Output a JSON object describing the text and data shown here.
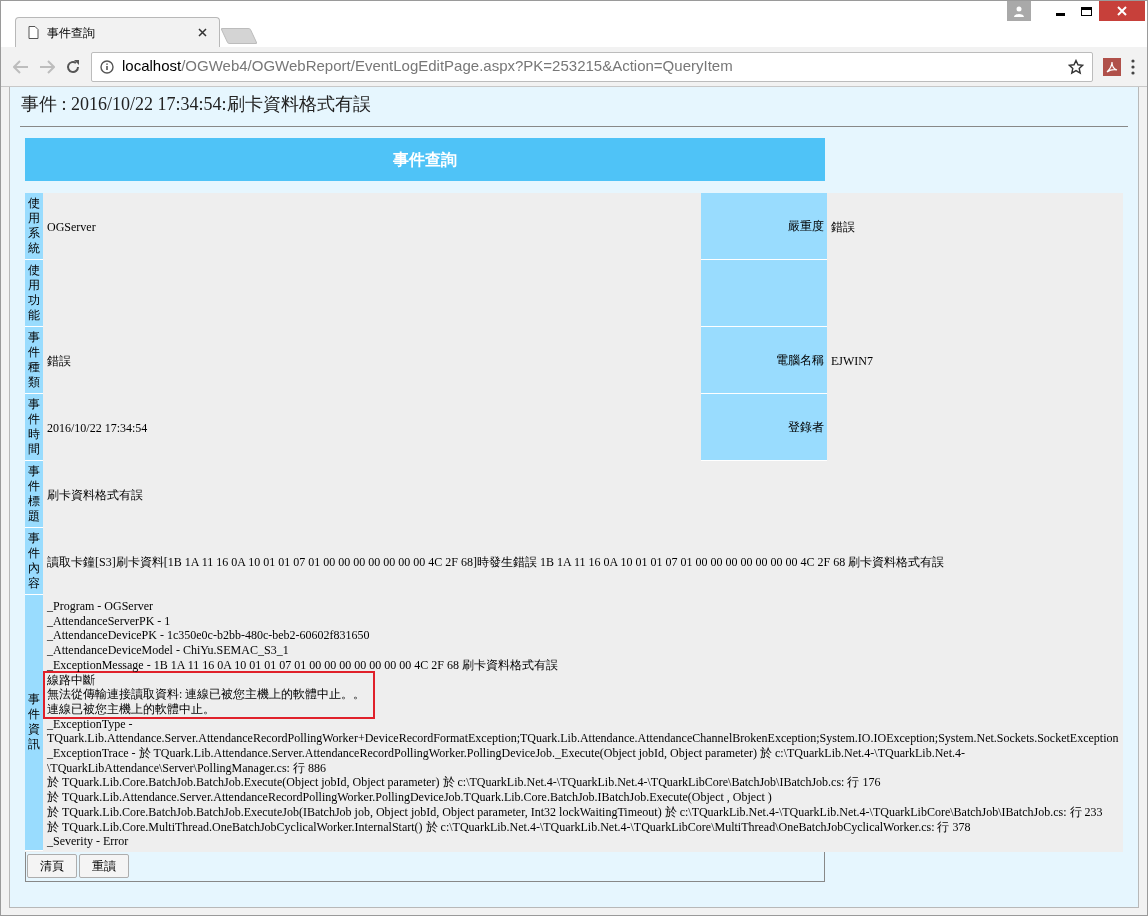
{
  "browser": {
    "tab_title": "事件查詢",
    "url_host": "localhost",
    "url_path": "/OGWeb4/OGWebReport/EventLogEditPage.aspx?PK=253215&Action=QueryItem"
  },
  "page_title": "事件 : 2016/10/22 17:34:54:刷卡資料格式有誤",
  "panel_title": "事件查詢",
  "rows": [
    {
      "label": "使用系統",
      "value": "OGServer",
      "right_label": "嚴重度",
      "right_value": "錯誤",
      "has_right": true
    },
    {
      "label": "使用功能",
      "has_right": true
    },
    {
      "label": "事件種類",
      "value": "錯誤",
      "right_label": "電腦名稱",
      "right_value": "EJWIN7",
      "has_right": true
    },
    {
      "label": "事件時間",
      "value": "2016/10/22 17:34:54",
      "right_label": "登錄者",
      "has_right": true
    },
    {
      "label": "事件標題",
      "value": "刷卡資料格式有誤",
      "has_right": false
    },
    {
      "label": "事件內容",
      "value": "讀取卡鐘[S3]刷卡資料[1B 1A 11 16 0A 10 01 01 07 01 00 00 00 00 00 00 00 4C 2F 68]時發生錯誤 1B 1A 11 16 0A 10 01 01 07 01 00 00 00 00 00 00 00 4C 2F 68 刷卡資料格式有誤",
      "has_right": false
    }
  ],
  "info": {
    "label": "事件資訊",
    "lines": [
      {
        "text": "_Program - OGServer",
        "highlighted": false
      },
      {
        "text": "_AttendanceServerPK - 1",
        "highlighted": false
      },
      {
        "text": "_AttendanceDevicePK - 1c350e0c-b2bb-480c-beb2-60602f831650",
        "highlighted": false
      },
      {
        "text": "_AttendanceDeviceModel - ChiYu.SEMAC_S3_1",
        "highlighted": false
      },
      {
        "text": "_ExceptionMessage - 1B 1A 11 16 0A 10 01 01 07 01 00 00 00 00 00 00 00 4C 2F 68 刷卡資料格式有誤",
        "highlighted": false
      },
      {
        "text": "線路中斷",
        "highlighted": true
      },
      {
        "text": "無法從傳輸連接讀取資料: 連線已被您主機上的軟體中止。。",
        "highlighted": true
      },
      {
        "text": "連線已被您主機上的軟體中止。",
        "highlighted": true
      },
      {
        "text": "_ExceptionType -",
        "highlighted": false
      },
      {
        "text": "TQuark.Lib.Attendance.Server.AttendanceRecordPollingWorker+DeviceRecordFormatException;TQuark.Lib.Attendance.AttendanceChannelBrokenException;System.IO.IOException;System.Net.Sockets.SocketException",
        "highlighted": false
      },
      {
        "text": "_ExceptionTrace - 於 TQuark.Lib.Attendance.Server.AttendanceRecordPollingWorker.PollingDeviceJob._Execute(Object jobId, Object parameter) 於 c:\\TQuarkLib.Net.4-\\TQuarkLib.Net.4-",
        "highlighted": false
      },
      {
        "text": "\\TQuarkLibAttendance\\Server\\PollingManager.cs: 行 886",
        "highlighted": false
      },
      {
        "text": "於 TQuark.Lib.Core.BatchJob.BatchJob.Execute(Object jobId, Object parameter) 於 c:\\TQuarkLib.Net.4-\\TQuarkLib.Net.4-\\TQuarkLibCore\\BatchJob\\IBatchJob.cs: 行 176",
        "highlighted": false
      },
      {
        "text": "於 TQuark.Lib.Attendance.Server.AttendanceRecordPollingWorker.PollingDeviceJob.TQuark.Lib.Core.BatchJob.IBatchJob.Execute(Object , Object )",
        "highlighted": false
      },
      {
        "text": "於 TQuark.Lib.Core.BatchJob.BatchJob.ExecuteJob(IBatchJob job, Object jobId, Object parameter, Int32 lockWaitingTimeout) 於 c:\\TQuarkLib.Net.4-\\TQuarkLib.Net.4-\\TQuarkLibCore\\BatchJob\\IBatchJob.cs: 行 233",
        "highlighted": false
      },
      {
        "text": "於 TQuark.Lib.Core.MultiThread.OneBatchJobCyclicalWorker.InternalStart() 於 c:\\TQuarkLib.Net.4-\\TQuarkLib.Net.4-\\TQuarkLibCore\\MultiThread\\OneBatchJobCyclicalWorker.cs: 行 378",
        "highlighted": false
      },
      {
        "text": "_Severity - Error",
        "highlighted": false
      }
    ]
  },
  "buttons": [
    "清頁",
    "重讀"
  ]
}
